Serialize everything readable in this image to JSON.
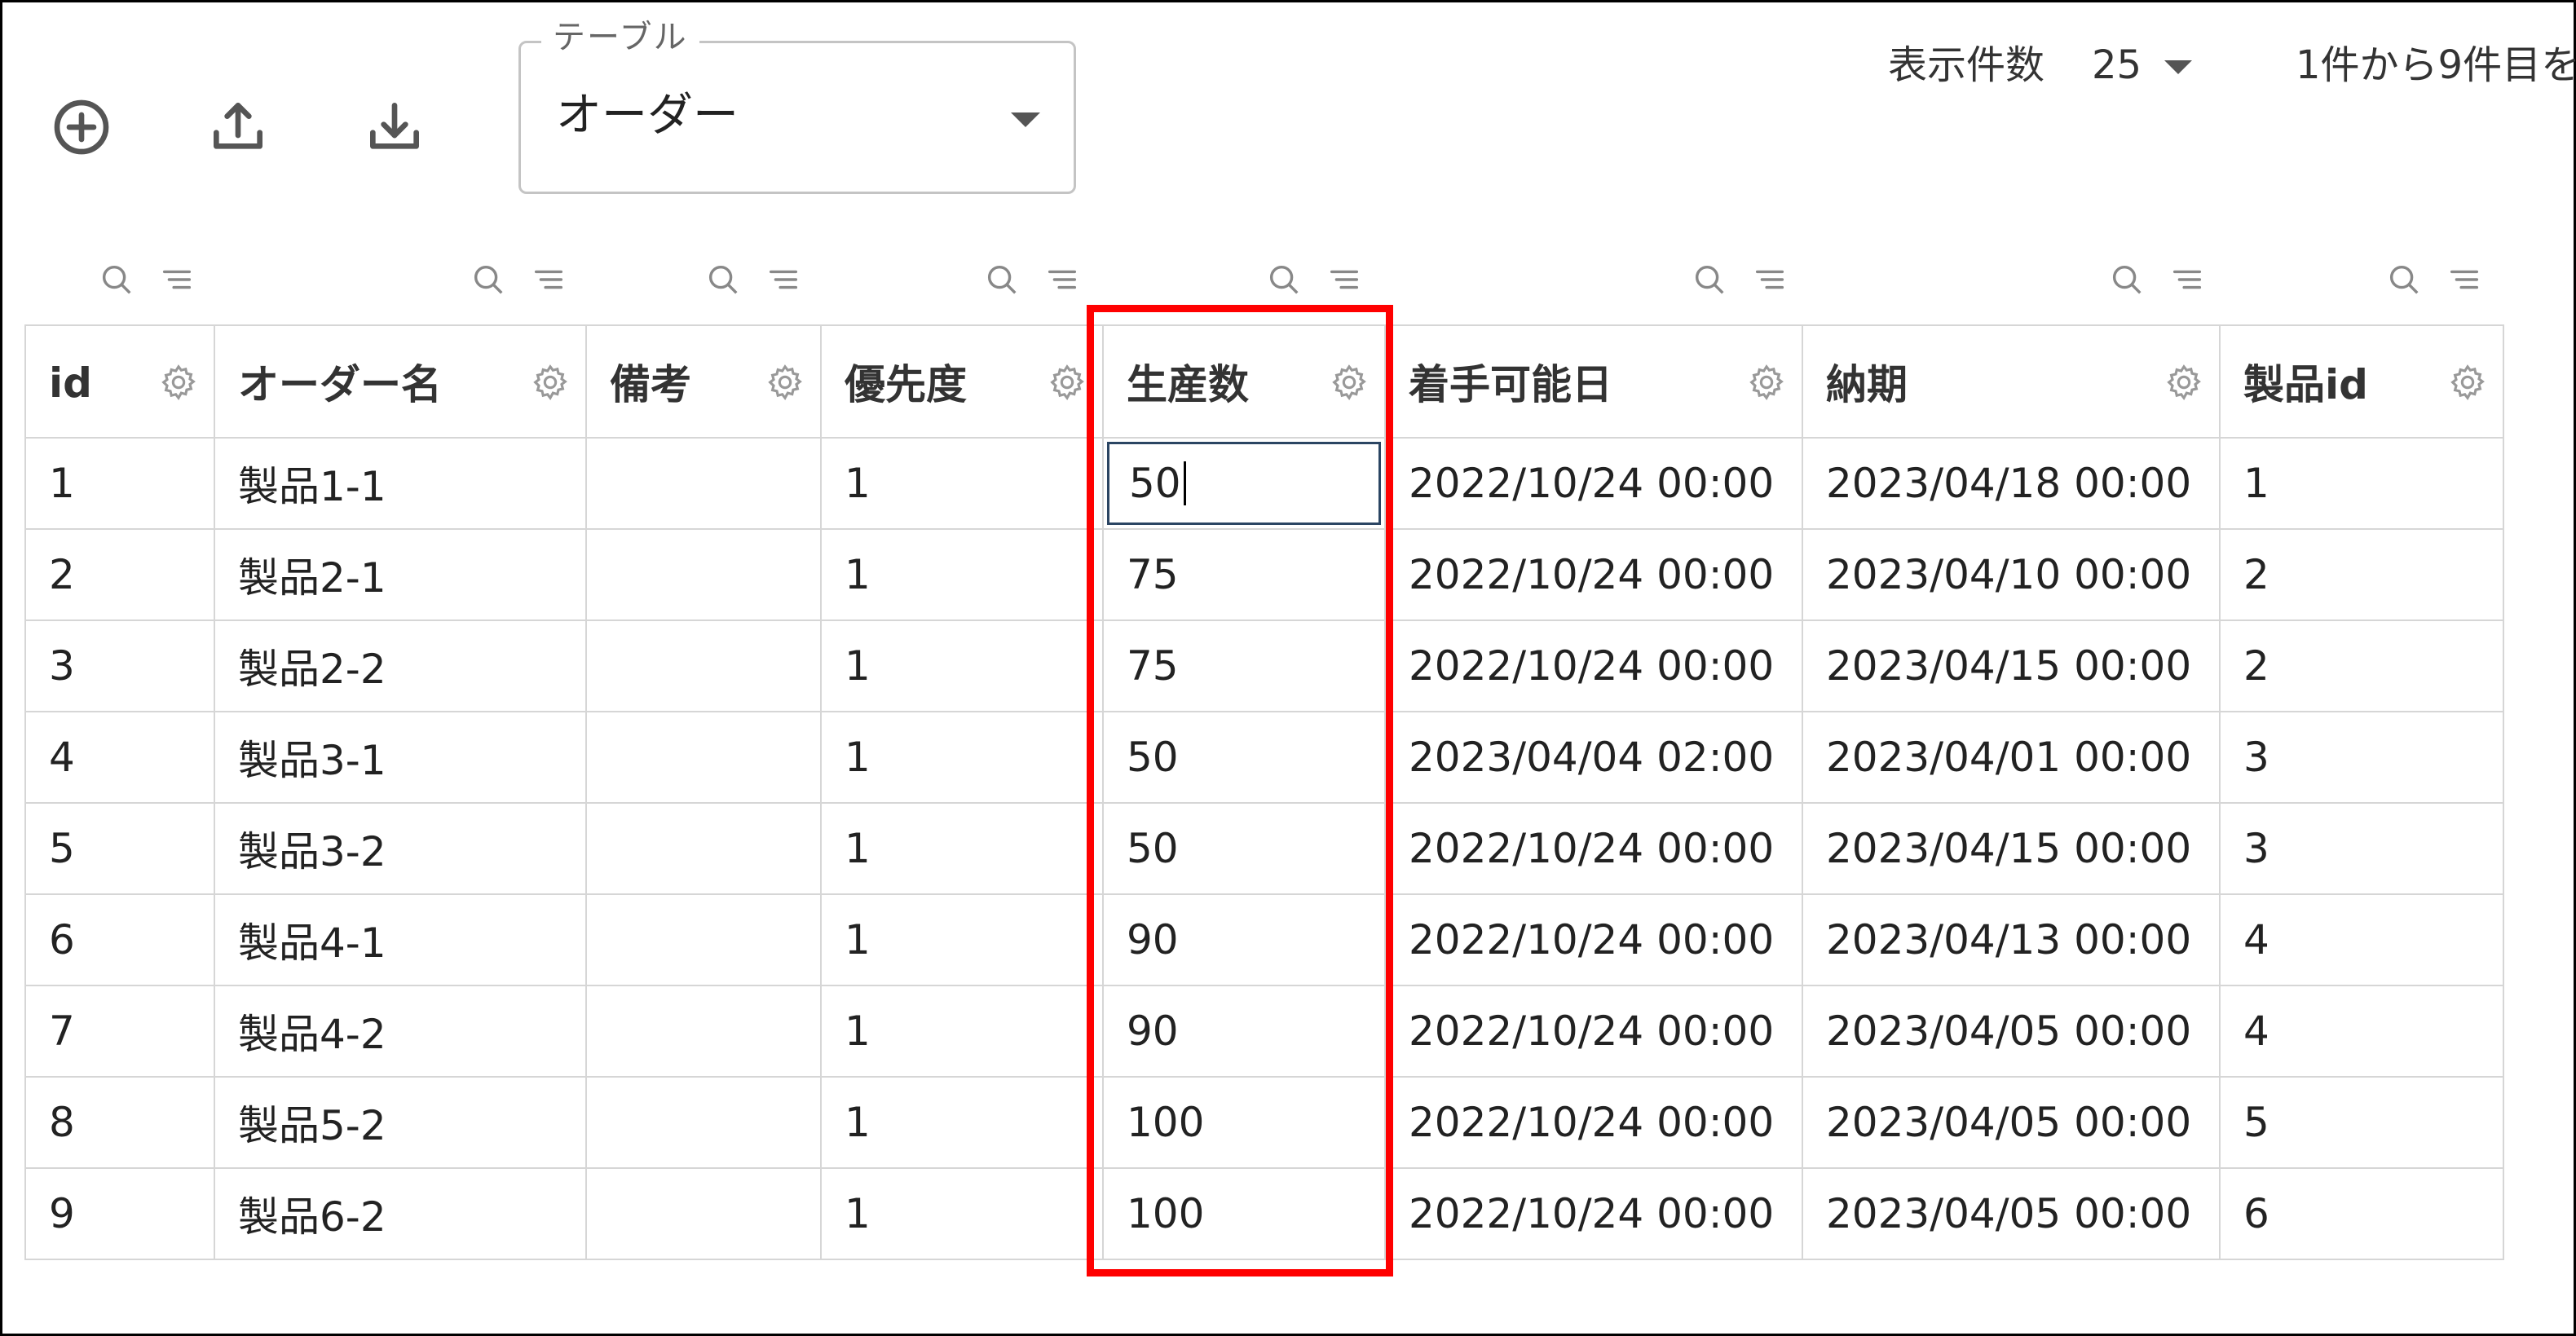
{
  "toolbar": {
    "add_icon": "add-circle-icon",
    "upload_icon": "upload-icon",
    "download_icon": "download-icon"
  },
  "table_select": {
    "legend": "テーブル",
    "value": "オーダー"
  },
  "pager": {
    "rows_label": "表示件数",
    "rows_value": "25",
    "range_text": "1件から9件目を"
  },
  "columns": [
    {
      "label": "id"
    },
    {
      "label": "オーダー名"
    },
    {
      "label": "備考"
    },
    {
      "label": "優先度"
    },
    {
      "label": "生産数"
    },
    {
      "label": "着手可能日"
    },
    {
      "label": "納期"
    },
    {
      "label": "製品id"
    }
  ],
  "rows": [
    {
      "id": "1",
      "name": "製品1-1",
      "note": "",
      "priority": "1",
      "qty": "50",
      "start": "2022/10/24 00:00",
      "due": "2023/04/18 00:00",
      "product_id": "1"
    },
    {
      "id": "2",
      "name": "製品2-1",
      "note": "",
      "priority": "1",
      "qty": "75",
      "start": "2022/10/24 00:00",
      "due": "2023/04/10 00:00",
      "product_id": "2"
    },
    {
      "id": "3",
      "name": "製品2-2",
      "note": "",
      "priority": "1",
      "qty": "75",
      "start": "2022/10/24 00:00",
      "due": "2023/04/15 00:00",
      "product_id": "2"
    },
    {
      "id": "4",
      "name": "製品3-1",
      "note": "",
      "priority": "1",
      "qty": "50",
      "start": "2023/04/04 02:00",
      "due": "2023/04/01 00:00",
      "product_id": "3"
    },
    {
      "id": "5",
      "name": "製品3-2",
      "note": "",
      "priority": "1",
      "qty": "50",
      "start": "2022/10/24 00:00",
      "due": "2023/04/15 00:00",
      "product_id": "3"
    },
    {
      "id": "6",
      "name": "製品4-1",
      "note": "",
      "priority": "1",
      "qty": "90",
      "start": "2022/10/24 00:00",
      "due": "2023/04/13 00:00",
      "product_id": "4"
    },
    {
      "id": "7",
      "name": "製品4-2",
      "note": "",
      "priority": "1",
      "qty": "90",
      "start": "2022/10/24 00:00",
      "due": "2023/04/05 00:00",
      "product_id": "4"
    },
    {
      "id": "8",
      "name": "製品5-2",
      "note": "",
      "priority": "1",
      "qty": "100",
      "start": "2022/10/24 00:00",
      "due": "2023/04/05 00:00",
      "product_id": "5"
    },
    {
      "id": "9",
      "name": "製品6-2",
      "note": "",
      "priority": "1",
      "qty": "100",
      "start": "2022/10/24 00:00",
      "due": "2023/04/05 00:00",
      "product_id": "6"
    }
  ],
  "colors": {
    "highlight": "#ff0000",
    "editor_border": "#2b4563",
    "grid_border": "#d6d6d6"
  }
}
